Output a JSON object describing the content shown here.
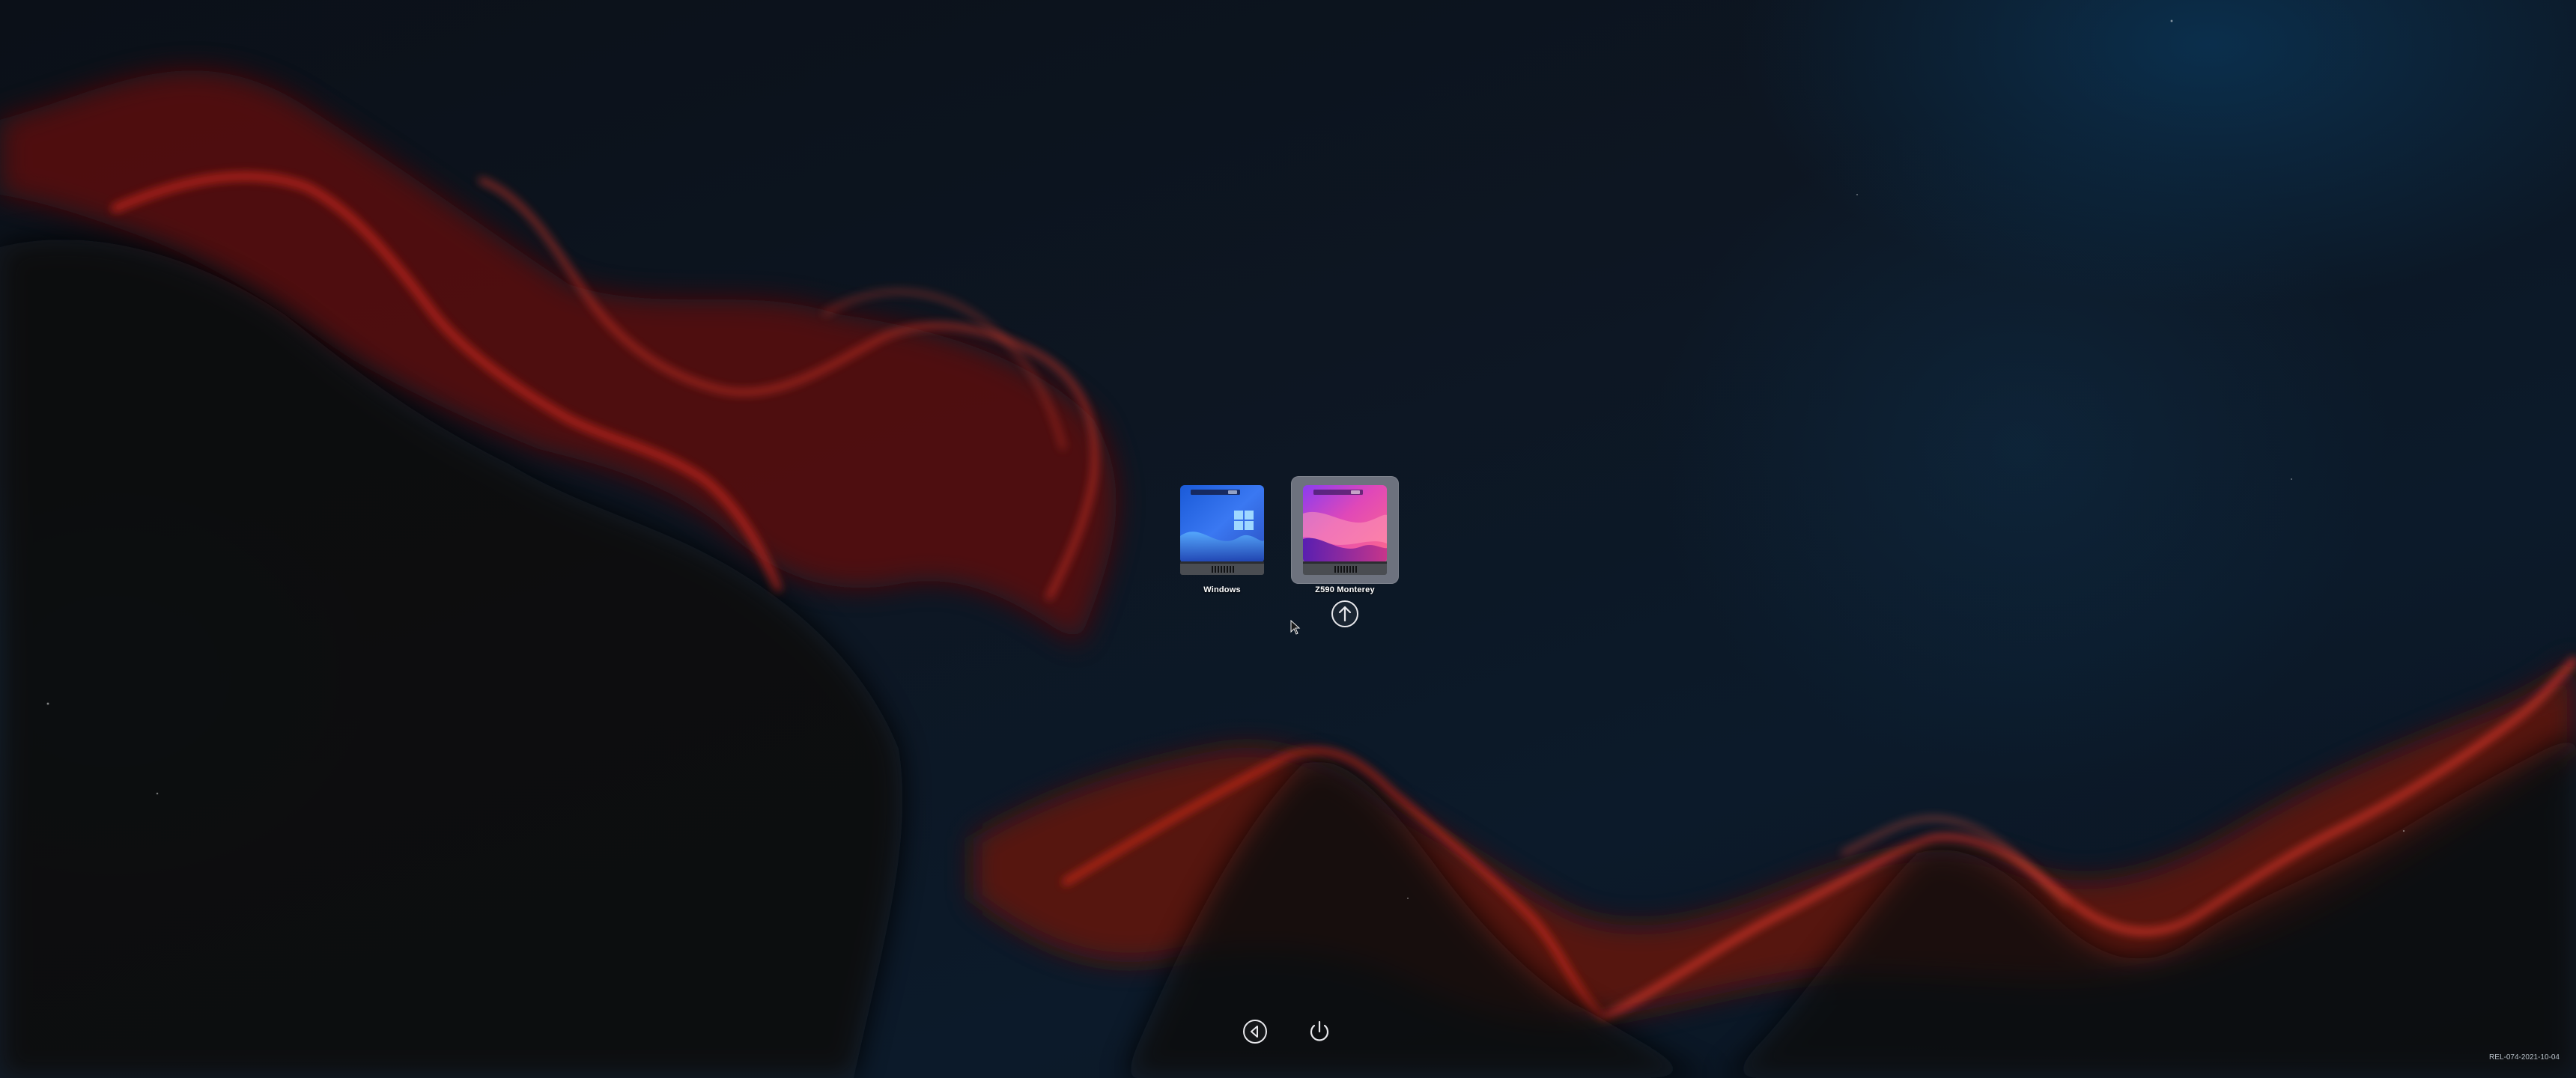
{
  "picker": {
    "disks": [
      {
        "label": "Windows",
        "icon": "windows-disk-icon",
        "selected": false
      },
      {
        "label": "Z590 Monterey",
        "icon": "macos-monterey-disk-icon",
        "selected": true
      }
    ],
    "boot_icon": "up-arrow-circle-icon"
  },
  "controls": {
    "back_icon": "back-arrow-circle-icon",
    "power_icon": "power-icon"
  },
  "footer": {
    "version": "REL-074-2021-10-04"
  },
  "colors": {
    "nebula_red": "#d22a1e",
    "background_blue": "#0c1a2a",
    "selection": "#bebec8"
  }
}
